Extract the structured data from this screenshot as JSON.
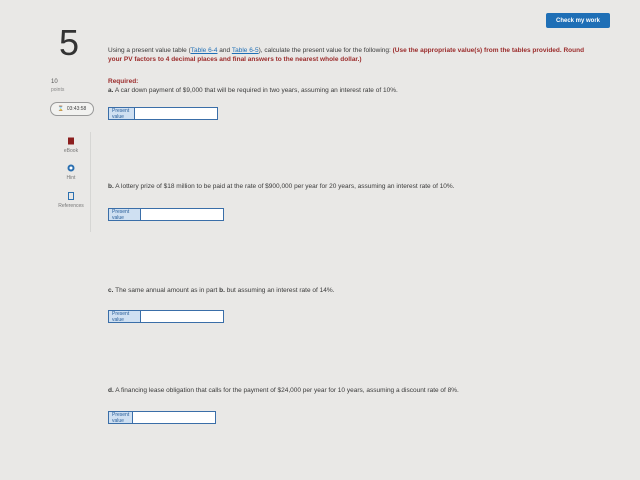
{
  "header": {
    "check_button": "Check my work"
  },
  "question": {
    "number": "5",
    "points_value": "10",
    "points_label": "points"
  },
  "timer": {
    "value": "03:43:58"
  },
  "tools": [
    {
      "label": "eBook",
      "icon": "book-icon"
    },
    {
      "label": "Hint",
      "icon": "lifebuoy-icon"
    },
    {
      "label": "References",
      "icon": "document-icon"
    }
  ],
  "prompt": {
    "intro": "Using a present value table (",
    "link1": "Table 6-4",
    "and": " and ",
    "link2": "Table 6-5",
    "rest": "), calculate the present value for the following: ",
    "instruction": "(Use the appropriate value(s) from the tables provided. Round your PV factors to 4 decimal places and final answers to the nearest whole dollar.)"
  },
  "required": "Required:",
  "parts": [
    {
      "prefix": "a.",
      "text": " A car down payment of $9,000 that will be required in two years, assuming an interest rate of 10%.",
      "field_label": "Present value",
      "value": ""
    },
    {
      "prefix": "b.",
      "text": " A lottery prize of $18 million to be paid at the rate of $900,000 per year for 20 years, assuming an interest rate of 10%.",
      "field_label": "Present value",
      "value": ""
    },
    {
      "prefix": "c.",
      "text_before": " The same annual amount as in part ",
      "bold": "b.",
      "text_after": " but assuming an interest rate of 14%.",
      "field_label": "Present value",
      "value": ""
    },
    {
      "prefix": "d.",
      "text": " A financing lease obligation that calls for the payment of $24,000 per year for 10 years, assuming a discount rate of 8%.",
      "field_label": "Present value",
      "value": ""
    }
  ]
}
